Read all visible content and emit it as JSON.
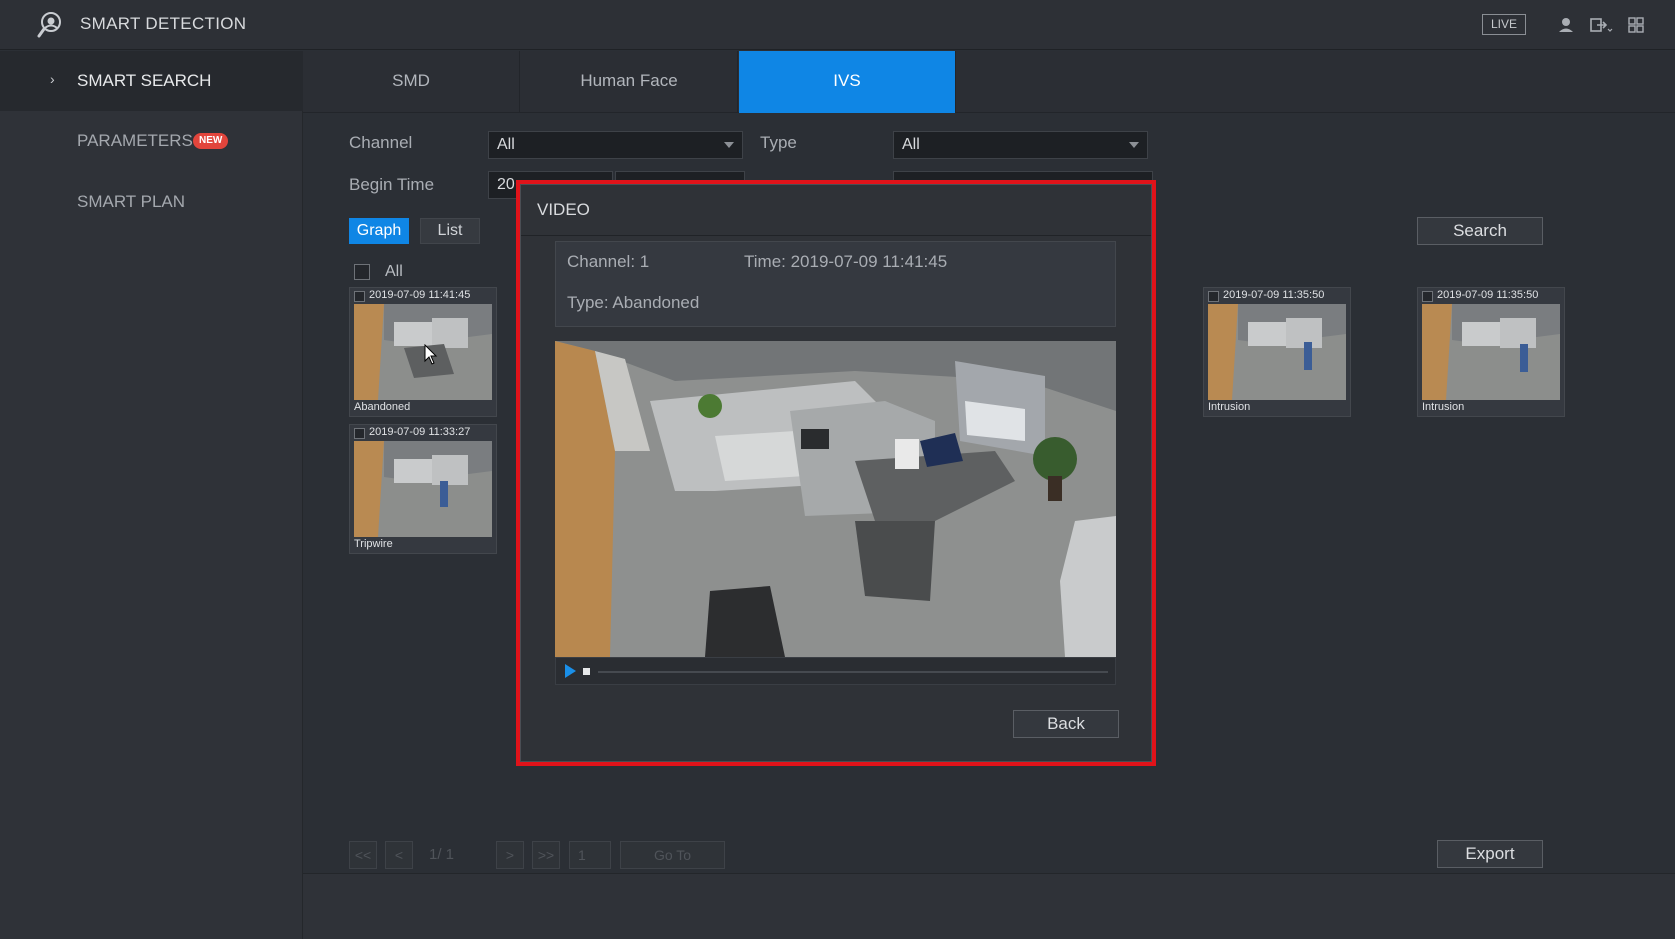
{
  "app": {
    "title": "SMART DETECTION",
    "live_label": "LIVE",
    "icons": [
      "smart-detection-logo-icon",
      "user-icon",
      "logout-icon",
      "layout-grid-icon"
    ]
  },
  "sidebar": {
    "items": [
      {
        "label": "SMART SEARCH",
        "active": true
      },
      {
        "label": "PARAMETERS",
        "badge": "NEW"
      },
      {
        "label": "SMART PLAN"
      }
    ]
  },
  "tabs": [
    {
      "label": "SMD"
    },
    {
      "label": "Human Face"
    },
    {
      "label": "IVS",
      "active": true
    }
  ],
  "filters": {
    "channel_label": "Channel",
    "channel_value": "All",
    "type_label": "Type",
    "type_value": "All",
    "begin_time_label": "Begin Time",
    "begin_time_value": "20"
  },
  "view_modes": {
    "graph": "Graph",
    "list": "List",
    "selected": "Graph"
  },
  "search_label": "Search",
  "select_all_label": "All",
  "results": [
    {
      "time": "2019-07-09 11:41:45",
      "type": "Abandoned"
    },
    {
      "time": "2019-07-09 11:33:27",
      "type": "Tripwire"
    },
    {
      "time": "2019-07-09 11:35:50",
      "type": "Intrusion"
    },
    {
      "time": "2019-07-09 11:35:50",
      "type": "Intrusion"
    }
  ],
  "pagination": {
    "first": "<<",
    "prev": "<",
    "page_text": "1/ 1",
    "next": ">",
    "last": ">>",
    "page_input": "1",
    "goto_label": "Go To"
  },
  "export_label": "Export",
  "video_modal": {
    "title": "VIDEO",
    "channel": "Channel: 1",
    "time": "Time: 2019-07-09 11:41:45",
    "type": "Type: Abandoned",
    "progress": 0,
    "back_label": "Back"
  }
}
